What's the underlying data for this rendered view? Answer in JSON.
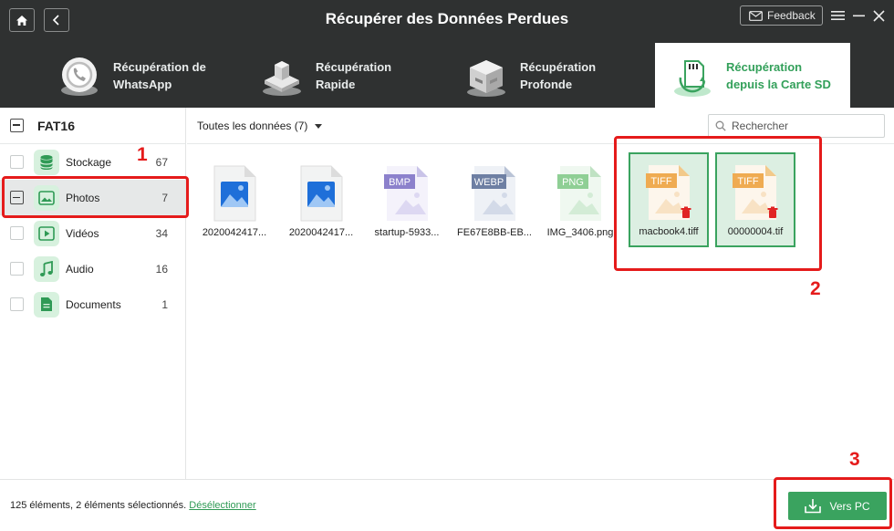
{
  "header": {
    "title": "Récupérer des Données Perdues",
    "feedback_label": "Feedback",
    "modes": [
      {
        "label": "Récupération de\nWhatsApp",
        "icon": "whatsapp-phone-icon"
      },
      {
        "label": "Récupération\nRapide",
        "icon": "quick-recovery-icon"
      },
      {
        "label": "Récupération\nProfonde",
        "icon": "deep-recovery-icon"
      },
      {
        "label": "Récupération\ndepuis la Carte SD",
        "icon": "sd-card-icon",
        "active": true
      }
    ]
  },
  "sidebar": {
    "drive": "FAT16",
    "categories": [
      {
        "label": "Stockage",
        "count": "67",
        "icon": "database-icon"
      },
      {
        "label": "Photos",
        "count": "7",
        "icon": "photo-icon",
        "selected": true
      },
      {
        "label": "Vidéos",
        "count": "34",
        "icon": "video-icon"
      },
      {
        "label": "Audio",
        "count": "16",
        "icon": "music-icon"
      },
      {
        "label": "Documents",
        "count": "1",
        "icon": "document-icon"
      }
    ]
  },
  "filter": {
    "label": "Toutes les données (7)",
    "search_placeholder": "Rechercher"
  },
  "files": [
    {
      "name": "2020042417...",
      "type": "image"
    },
    {
      "name": "2020042417...",
      "type": "image"
    },
    {
      "name": "startup-5933...",
      "type": "BMP"
    },
    {
      "name": "FE67E8BB-EB...",
      "type": "WEBP"
    },
    {
      "name": "IMG_3406.png",
      "type": "PNG"
    },
    {
      "name": "macbook4.tiff",
      "type": "TIFF",
      "selected": true
    },
    {
      "name": "00000004.tif",
      "type": "TIFF",
      "selected": true
    }
  ],
  "footer": {
    "status": "125 éléments, 2 éléments sélectionnés.",
    "deselect": "Désélectionner",
    "to_pc": "Vers PC"
  },
  "annotations": [
    "1",
    "2",
    "3"
  ],
  "colors": {
    "accent_green": "#3aa35f",
    "header_bg": "#2f3131",
    "annotation_red": "#e51b1b"
  }
}
